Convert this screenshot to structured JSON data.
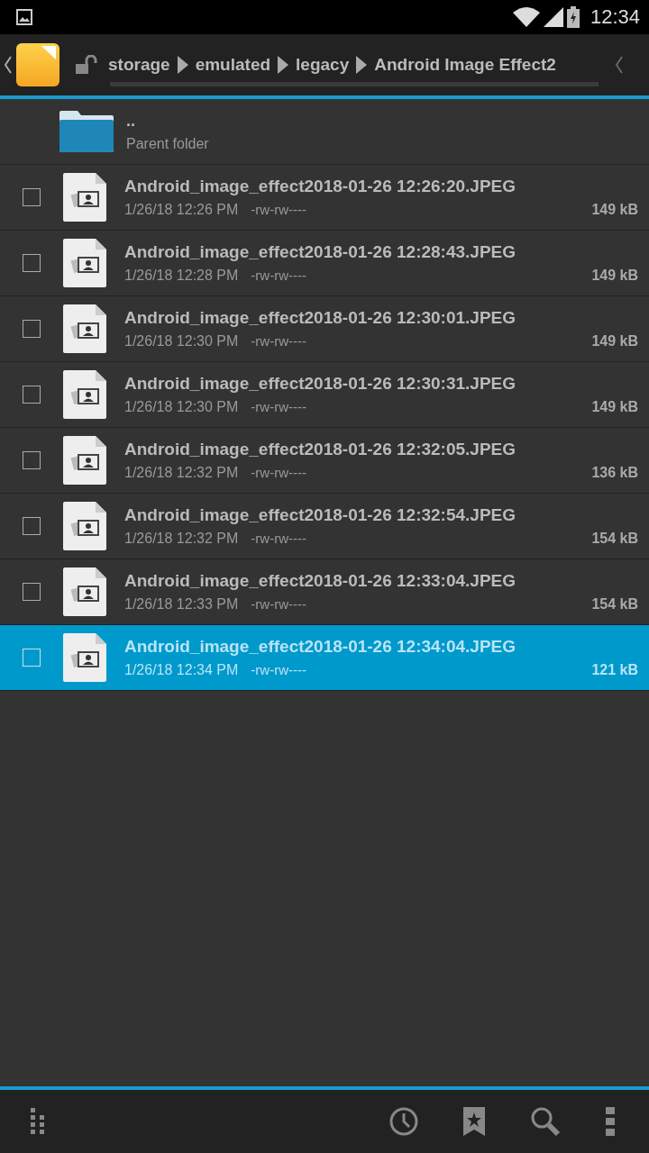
{
  "status_bar": {
    "time": "12:34"
  },
  "path": [
    "storage",
    "emulated",
    "legacy",
    "Android Image Effect2"
  ],
  "parent": {
    "name": "..",
    "label": "Parent folder"
  },
  "files": [
    {
      "name": "Android_image_effect2018-01-26 12:26:20.JPEG",
      "date": "1/26/18 12:26 PM",
      "permissions": "-rw-rw----",
      "size": "149 kB",
      "checked": false,
      "selected": false
    },
    {
      "name": "Android_image_effect2018-01-26 12:28:43.JPEG",
      "date": "1/26/18 12:28 PM",
      "permissions": "-rw-rw----",
      "size": "149 kB",
      "checked": false,
      "selected": false
    },
    {
      "name": "Android_image_effect2018-01-26 12:30:01.JPEG",
      "date": "1/26/18 12:30 PM",
      "permissions": "-rw-rw----",
      "size": "149 kB",
      "checked": false,
      "selected": false
    },
    {
      "name": "Android_image_effect2018-01-26 12:30:31.JPEG",
      "date": "1/26/18 12:30 PM",
      "permissions": "-rw-rw----",
      "size": "149 kB",
      "checked": false,
      "selected": false
    },
    {
      "name": "Android_image_effect2018-01-26 12:32:05.JPEG",
      "date": "1/26/18 12:32 PM",
      "permissions": "-rw-rw----",
      "size": "136 kB",
      "checked": false,
      "selected": false
    },
    {
      "name": "Android_image_effect2018-01-26 12:32:54.JPEG",
      "date": "1/26/18 12:32 PM",
      "permissions": "-rw-rw----",
      "size": "154 kB",
      "checked": false,
      "selected": false
    },
    {
      "name": "Android_image_effect2018-01-26 12:33:04.JPEG",
      "date": "1/26/18 12:33 PM",
      "permissions": "-rw-rw----",
      "size": "154 kB",
      "checked": false,
      "selected": false
    },
    {
      "name": "Android_image_effect2018-01-26 12:34:04.JPEG",
      "date": "1/26/18 12:34 PM",
      "permissions": "-rw-rw----",
      "size": "121 kB",
      "checked": false,
      "selected": true
    }
  ]
}
